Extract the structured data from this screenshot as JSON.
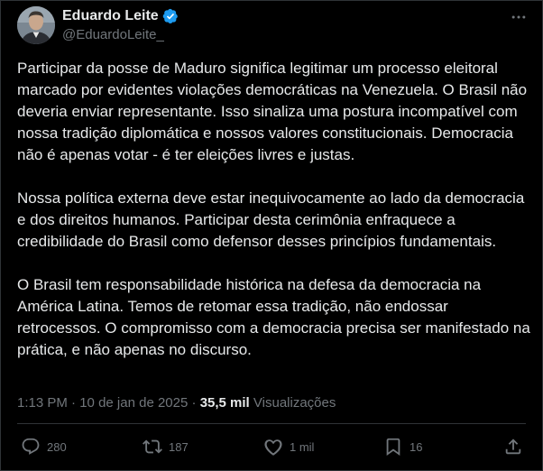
{
  "author": {
    "display_name": "Eduardo Leite",
    "handle": "@EduardoLeite_"
  },
  "tweet": {
    "paragraphs": [
      "Participar da posse de Maduro significa legitimar um processo eleitoral marcado por evidentes violações democráticas na Venezuela. O Brasil não deveria enviar representante. Isso sinaliza uma postura incompatível com nossa tradição diplomática e nossos valores constitucionais. Democracia não é apenas votar - é ter eleições livres e justas.",
      "Nossa política externa deve estar inequivocamente ao lado da democracia e dos direitos humanos. Participar desta cerimônia enfraquece a credibilidade do Brasil como defensor desses princípios fundamentais.",
      "O Brasil tem responsabilidade histórica na defesa da democracia na América Latina. Temos de retomar essa tradição, não endossar retrocessos. O compromisso com a democracia precisa ser manifestado na prática, e não apenas no discurso."
    ],
    "time": "1:13 PM",
    "separator": "·",
    "date": "10 de jan de 2025",
    "views_count": "35,5 mil",
    "views_label": "Visualizações"
  },
  "actions": {
    "replies": "280",
    "reposts": "187",
    "likes": "1 mil",
    "bookmarks": "16"
  },
  "colors": {
    "background": "#000000",
    "text": "#e7e9ea",
    "secondary_text": "#71767b",
    "verified_badge": "#1d9bf0",
    "divider": "#2f3336"
  },
  "icons": {
    "verified": "verified-badge-icon",
    "more": "more-icon",
    "reply": "reply-icon",
    "repost": "repost-icon",
    "like": "heart-icon",
    "bookmark": "bookmark-icon",
    "share": "share-icon"
  }
}
